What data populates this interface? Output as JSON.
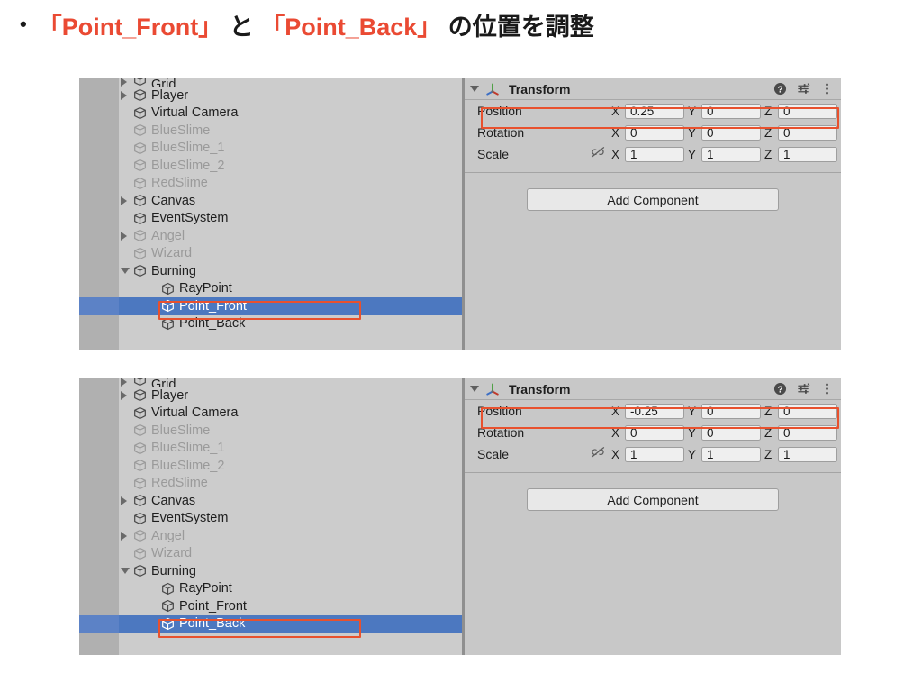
{
  "heading": {
    "bullet": "•",
    "segments": [
      {
        "text": "「Point_Front」",
        "color": "#ea4a33"
      },
      {
        "text": " と ",
        "color": "#1a1a1a"
      },
      {
        "text": "「Point_Back」",
        "color": "#ea4a33"
      },
      {
        "text": " の位置を調整",
        "color": "#1a1a1a"
      }
    ],
    "full_text": "「Point_Front」 と 「Point_Back」 の位置を調整"
  },
  "colors": {
    "accent_red": "#ea4a33",
    "annotation_red": "#e8512e",
    "selection_blue": "#4c78c0",
    "selection_blue_gutter": "#5c82c6",
    "panel_bg": "#c8c8c8",
    "hierarchy_bg": "#cccccc",
    "gutter_bg": "#b0b0b0",
    "field_bg": "#efefef",
    "dim_text": "#9a9a9a"
  },
  "hierarchy_rows": [
    {
      "label": "Grid",
      "indent": 1,
      "expander": "right",
      "dim": false,
      "clipped": true
    },
    {
      "label": "Player",
      "indent": 1,
      "expander": "right",
      "dim": false,
      "clipped": false
    },
    {
      "label": "Virtual Camera",
      "indent": 1,
      "expander": "none",
      "dim": false,
      "clipped": false
    },
    {
      "label": "BlueSlime",
      "indent": 1,
      "expander": "none",
      "dim": true,
      "clipped": false
    },
    {
      "label": "BlueSlime_1",
      "indent": 1,
      "expander": "none",
      "dim": true,
      "clipped": false
    },
    {
      "label": "BlueSlime_2",
      "indent": 1,
      "expander": "none",
      "dim": true,
      "clipped": false
    },
    {
      "label": "RedSlime",
      "indent": 1,
      "expander": "none",
      "dim": true,
      "clipped": false
    },
    {
      "label": "Canvas",
      "indent": 1,
      "expander": "right",
      "dim": false,
      "clipped": false
    },
    {
      "label": "EventSystem",
      "indent": 1,
      "expander": "none",
      "dim": false,
      "clipped": false
    },
    {
      "label": "Angel",
      "indent": 1,
      "expander": "right",
      "dim": true,
      "clipped": false
    },
    {
      "label": "Wizard",
      "indent": 1,
      "expander": "none",
      "dim": true,
      "clipped": false
    },
    {
      "label": "Burning",
      "indent": 1,
      "expander": "down",
      "dim": false,
      "clipped": false
    },
    {
      "label": "RayPoint",
      "indent": 2,
      "expander": "none",
      "dim": false,
      "clipped": false
    },
    {
      "label": "Point_Front",
      "indent": 2,
      "expander": "none",
      "dim": false,
      "clipped": false
    },
    {
      "label": "Point_Back",
      "indent": 2,
      "expander": "none",
      "dim": false,
      "clipped": false
    }
  ],
  "panels": [
    {
      "id": "panel-point-front",
      "selected_object": "Point_Front",
      "selected_row_index": 13,
      "inspector": {
        "component_title": "Transform",
        "component_icon": "transform-gizmo-icon",
        "header_icons": [
          "help-icon",
          "preset-settings-icon",
          "more-options-icon"
        ],
        "properties": [
          {
            "name": "Position",
            "has_link_toggle": false,
            "x": "0.25",
            "y": "0",
            "z": "0"
          },
          {
            "name": "Rotation",
            "has_link_toggle": false,
            "x": "0",
            "y": "0",
            "z": "0"
          },
          {
            "name": "Scale",
            "has_link_toggle": true,
            "x": "1",
            "y": "1",
            "z": "1"
          }
        ],
        "axis_labels": [
          "X",
          "Y",
          "Z"
        ],
        "add_component_label": "Add Component"
      }
    },
    {
      "id": "panel-point-back",
      "selected_object": "Point_Back",
      "selected_row_index": 14,
      "inspector": {
        "component_title": "Transform",
        "component_icon": "transform-gizmo-icon",
        "header_icons": [
          "help-icon",
          "preset-settings-icon",
          "more-options-icon"
        ],
        "properties": [
          {
            "name": "Position",
            "has_link_toggle": false,
            "x": "-0.25",
            "y": "0",
            "z": "0"
          },
          {
            "name": "Rotation",
            "has_link_toggle": false,
            "x": "0",
            "y": "0",
            "z": "0"
          },
          {
            "name": "Scale",
            "has_link_toggle": true,
            "x": "1",
            "y": "1",
            "z": "1"
          }
        ],
        "axis_labels": [
          "X",
          "Y",
          "Z"
        ],
        "add_component_label": "Add Component"
      }
    }
  ]
}
